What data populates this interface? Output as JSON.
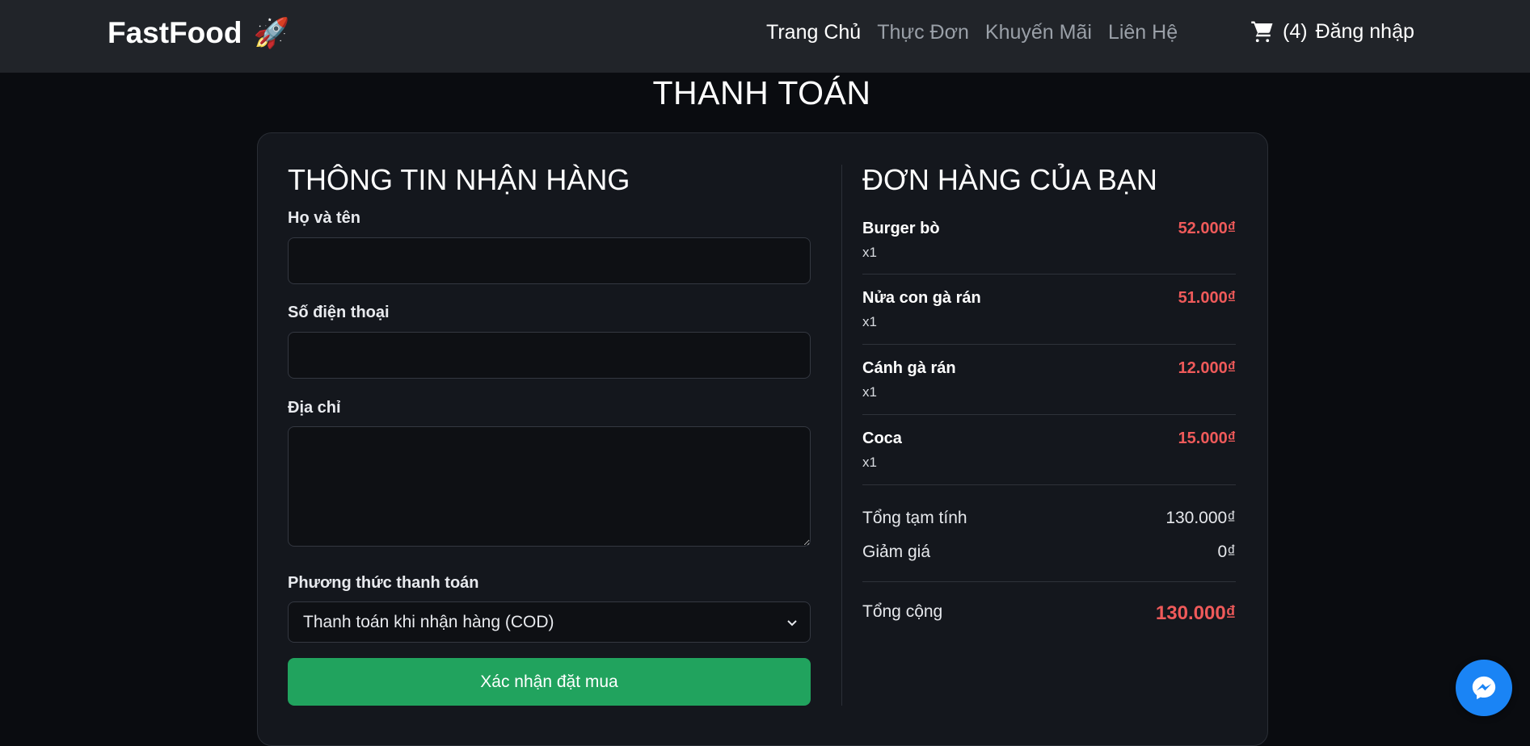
{
  "navbar": {
    "brand": "FastFood",
    "links": [
      {
        "label": "Trang Chủ",
        "active": true
      },
      {
        "label": "Thực Đơn",
        "active": false
      },
      {
        "label": "Khuyến Mãi",
        "active": false
      },
      {
        "label": "Liên Hệ",
        "active": false
      }
    ],
    "cart_count": "(4)",
    "login_label": "Đăng nhập",
    "cart_icon": "cart-icon",
    "brand_icon": "rocket-icon"
  },
  "page": {
    "title": "THANH TOÁN"
  },
  "shipping": {
    "title": "THÔNG TIN NHẬN HÀNG",
    "fullname_label": "Họ và tên",
    "fullname_value": "",
    "phone_label": "Số điện thoại",
    "phone_value": "",
    "address_label": "Địa chỉ",
    "address_value": "",
    "payment_label": "Phương thức thanh toán",
    "payment_selected": "Thanh toán khi nhận hàng (COD)",
    "submit_label": "Xác nhận đặt mua"
  },
  "order": {
    "title": "ĐƠN HÀNG CỦA BẠN",
    "items": [
      {
        "name": "Burger bò",
        "qty": "x1",
        "price": "52.000₫"
      },
      {
        "name": "Nửa con gà rán",
        "qty": "x1",
        "price": "51.000₫"
      },
      {
        "name": "Cánh gà rán",
        "qty": "x1",
        "price": "12.000₫"
      },
      {
        "name": "Coca",
        "qty": "x1",
        "price": "15.000₫"
      }
    ],
    "subtotal_label": "Tổng tạm tính",
    "subtotal_value": "130.000₫",
    "discount_label": "Giảm giá",
    "discount_value": "0₫",
    "total_label": "Tổng cộng",
    "total_value": "130.000₫"
  },
  "colors": {
    "accent_green": "#21a35e",
    "price_red": "#ef5a5a",
    "messenger_blue": "#1a84f5"
  },
  "widget": {
    "icon": "messenger-icon"
  }
}
